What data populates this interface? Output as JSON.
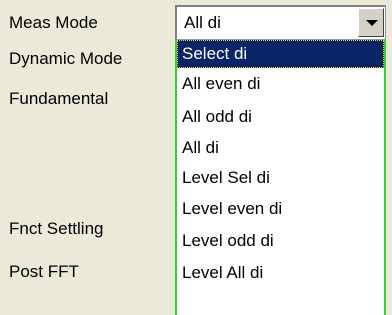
{
  "labels": {
    "meas_mode": "Meas Mode",
    "dynamic_mode": "Dynamic Mode",
    "fundamental": "Fundamental",
    "fnct_settling": "Fnct Settling",
    "post_fft": "Post FFT"
  },
  "combo": {
    "value": "All di"
  },
  "dropdown": {
    "options": [
      "Select di",
      "All even di",
      "All odd di",
      "All di",
      "Level Sel di",
      "Level even di",
      "Level odd di",
      "Level All di"
    ],
    "selected_index": 0
  },
  "colors": {
    "selected_bg": "#0a246a",
    "dropdown_border": "#2fd42f"
  }
}
